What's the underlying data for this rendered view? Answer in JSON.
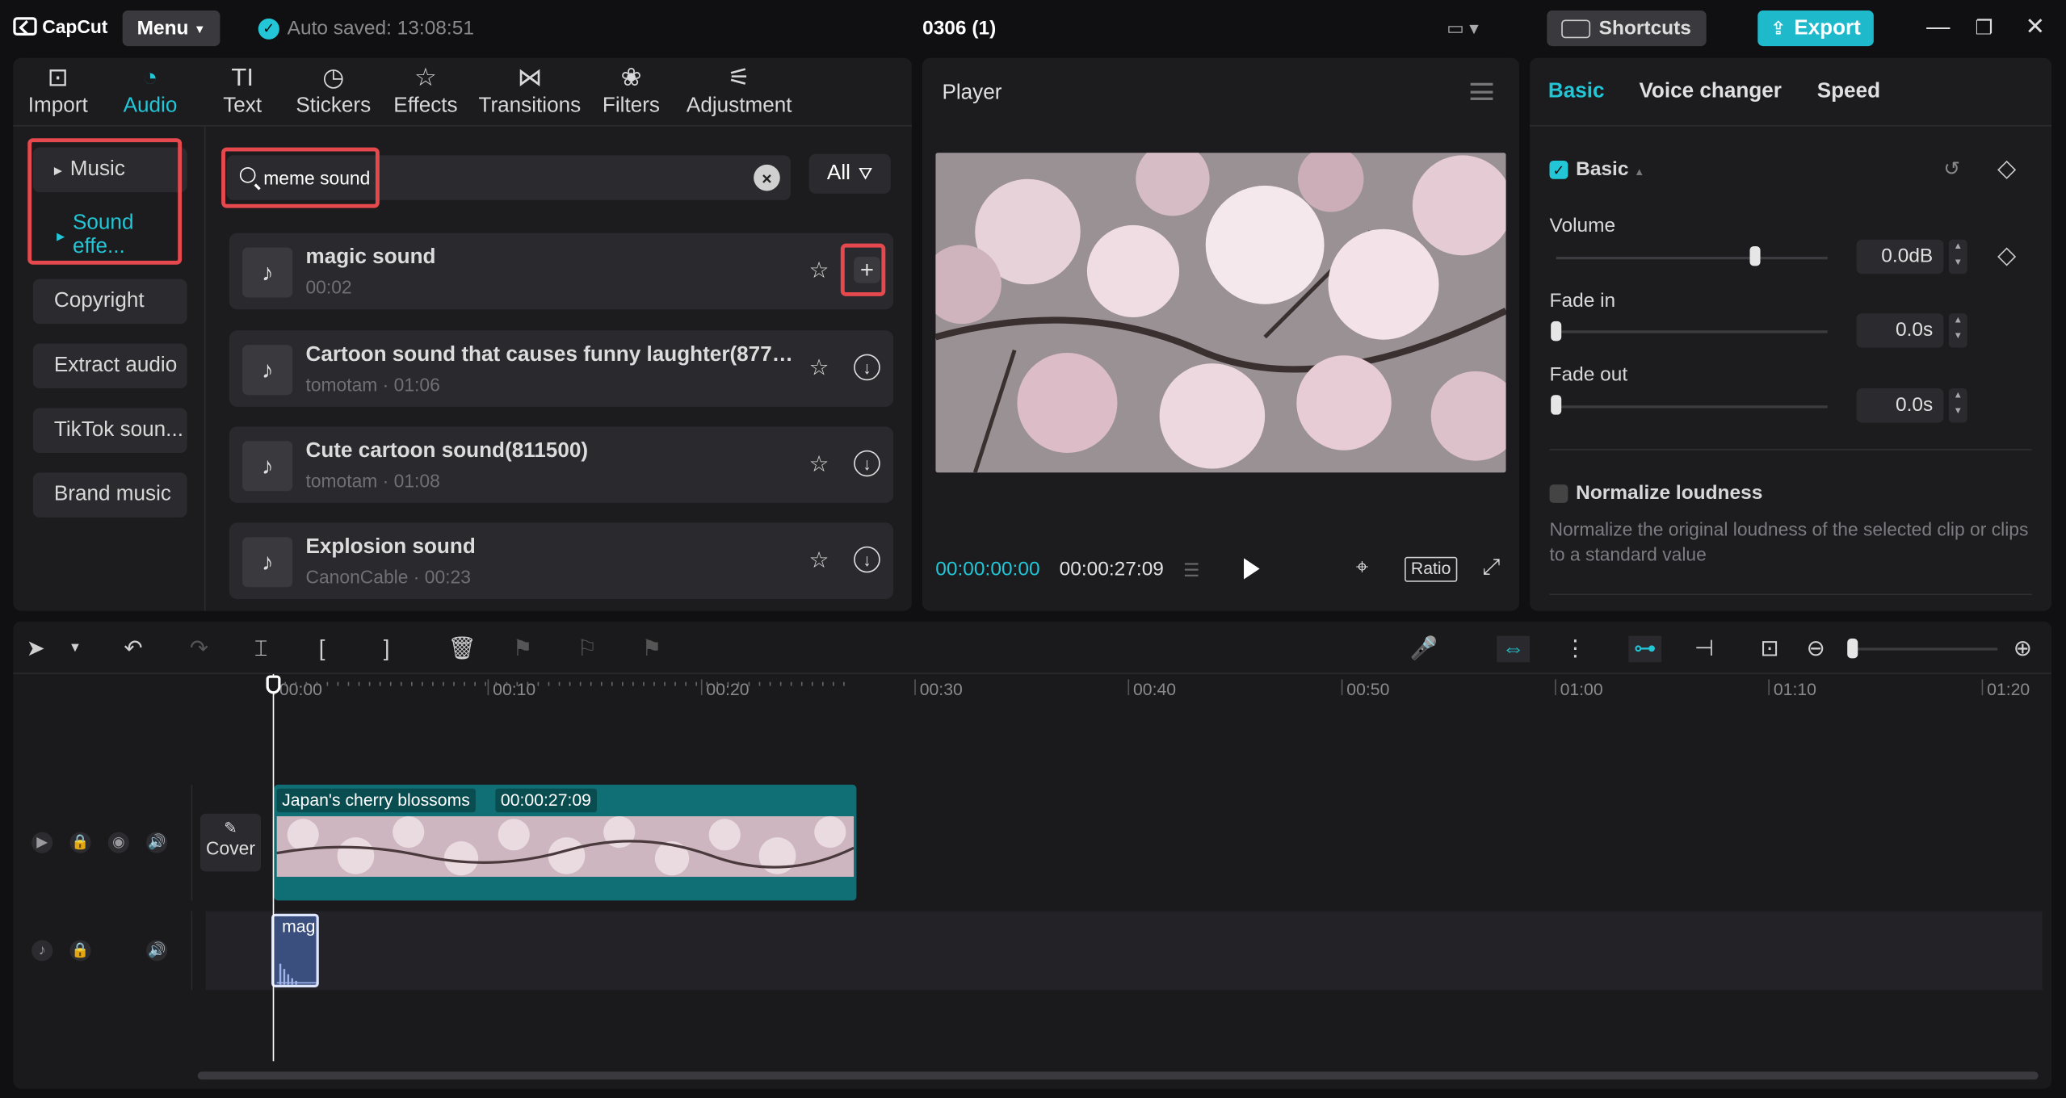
{
  "topbar": {
    "logo": "CapCut",
    "menu_label": "Menu",
    "autosave": "Auto saved: 13:08:51",
    "project_title": "0306 (1)",
    "shortcuts_label": "Shortcuts",
    "export_label": "Export"
  },
  "media": {
    "tabs": [
      {
        "label": "Import",
        "icon": "import-icon"
      },
      {
        "label": "Audio",
        "icon": "audio-icon"
      },
      {
        "label": "Text",
        "icon": "text-icon"
      },
      {
        "label": "Stickers",
        "icon": "stickers-icon"
      },
      {
        "label": "Effects",
        "icon": "effects-icon"
      },
      {
        "label": "Transitions",
        "icon": "transitions-icon"
      },
      {
        "label": "Filters",
        "icon": "filters-icon"
      },
      {
        "label": "Adjustment",
        "icon": "adjustment-icon"
      }
    ],
    "nav": [
      "Music",
      "Sound effe...",
      "Copyright",
      "Extract audio",
      "TikTok soun...",
      "Brand music"
    ],
    "search_value": "meme sound",
    "filter_label": "All",
    "sounds": [
      {
        "name": "magic sound",
        "meta": "00:02"
      },
      {
        "name": "Cartoon sound that causes funny laughter(8770...",
        "meta": "tomotam · 01:06"
      },
      {
        "name": "Cute cartoon sound(811500)",
        "meta": "tomotam · 01:08"
      },
      {
        "name": "Explosion sound",
        "meta": "CanonCable · 00:23"
      }
    ]
  },
  "player": {
    "title": "Player",
    "time_current": "00:00:00:00",
    "time_total": "00:00:27:09",
    "ratio_label": "Ratio"
  },
  "props": {
    "tabs": [
      "Basic",
      "Voice changer",
      "Speed"
    ],
    "section": "Basic",
    "volume_label": "Volume",
    "volume_value": "0.0dB",
    "fade_in_label": "Fade in",
    "fade_in_value": "0.0s",
    "fade_out_label": "Fade out",
    "fade_out_value": "0.0s",
    "normalize_label": "Normalize loudness",
    "normalize_desc": "Normalize the original loudness of the selected clip or clips to a standard value"
  },
  "timeline": {
    "ruler": [
      "00:00",
      "00:10",
      "00:20",
      "00:30",
      "00:40",
      "00:50",
      "01:00",
      "01:10",
      "01:20"
    ],
    "cover_label": "Cover",
    "video_clip_name": "Japan's cherry blossoms",
    "video_clip_duration": "00:00:27:09",
    "audio_clip_name": "mag"
  },
  "colors": {
    "accent": "#22c6d6",
    "highlight_box": "#e5484d",
    "video_track": "#0f6f74",
    "audio_clip": "#3a4f7e"
  }
}
